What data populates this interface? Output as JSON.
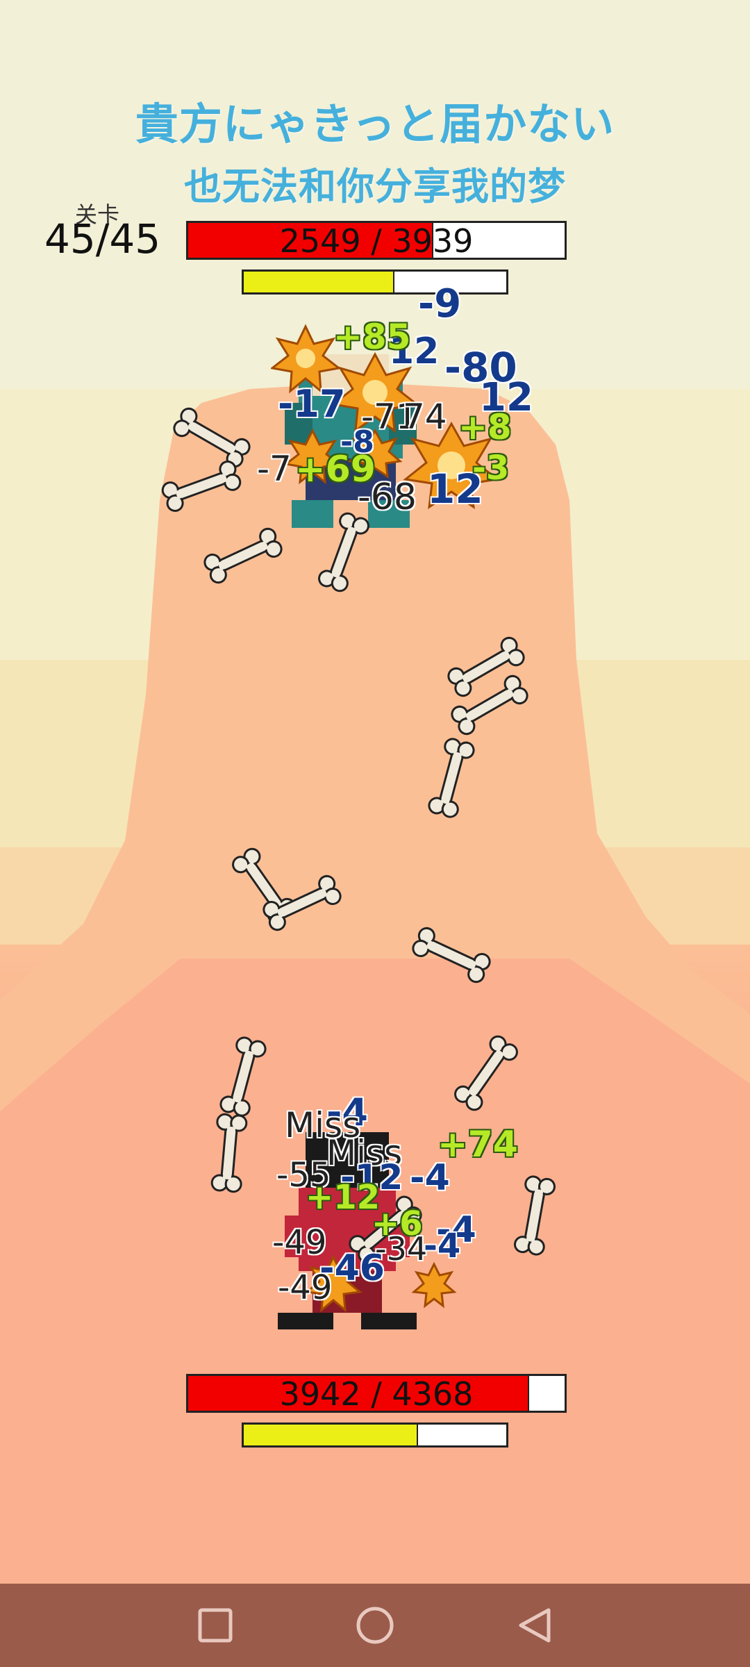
{
  "title_line1": "貴方にゃきっと届かない",
  "title_line2": "也无法和你分享我的梦",
  "level": {
    "label": "关卡",
    "value": "45/45"
  },
  "enemy": {
    "hp_text": "2549 / 3939",
    "hp_fraction": 0.647,
    "energy_fraction": 0.57
  },
  "player": {
    "hp_text": "3942 / 4368",
    "hp_fraction": 0.902,
    "energy_fraction": 0.66
  },
  "enemy_damage_numbers": [
    "-9",
    "-80",
    "12",
    "12",
    "+8",
    "12",
    "-7",
    "+69",
    "-68",
    "-17",
    "-71",
    "74",
    "-8",
    "+85",
    "-3"
  ],
  "player_damage_numbers": [
    "-4",
    "Miss",
    "Miss",
    "+74",
    "-4",
    "-55",
    "-12",
    "-4",
    "+12",
    "-49",
    "-4",
    "-46",
    "-49",
    "+6",
    "-34"
  ],
  "colors": {
    "title": "#45b0dc",
    "hp_fill": "#f20000",
    "energy_fill": "#ecef15",
    "nav_bar": "#9a5b4b"
  },
  "nav_icons": [
    "square-icon",
    "circle-icon",
    "triangle-back-icon"
  ]
}
